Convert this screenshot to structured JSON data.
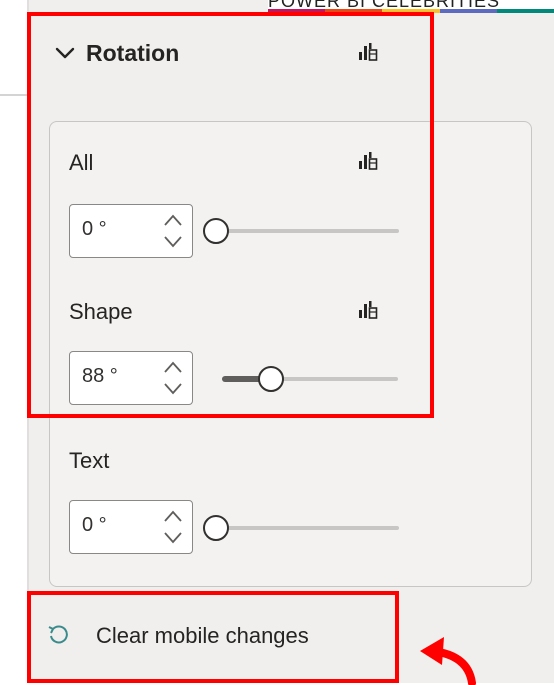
{
  "brand": {
    "text": "POWER BI CELEBRITIES",
    "colors": [
      "#c2185b",
      "#e64a19",
      "#fbc02d",
      "#5c6bc0",
      "#00897b"
    ]
  },
  "rotation": {
    "title": "Rotation",
    "expanded": true,
    "all": {
      "label": "All",
      "value": "0 °",
      "level": 0
    },
    "shape": {
      "label": "Shape",
      "value": "88 °",
      "level": 0.24
    },
    "text": {
      "label": "Text",
      "value": "0 °",
      "level": 0
    }
  },
  "clear_button": {
    "label": "Clear mobile changes"
  },
  "colors": {
    "highlight": "#ff0000",
    "panel": "#f0efed",
    "text": "#252423"
  }
}
